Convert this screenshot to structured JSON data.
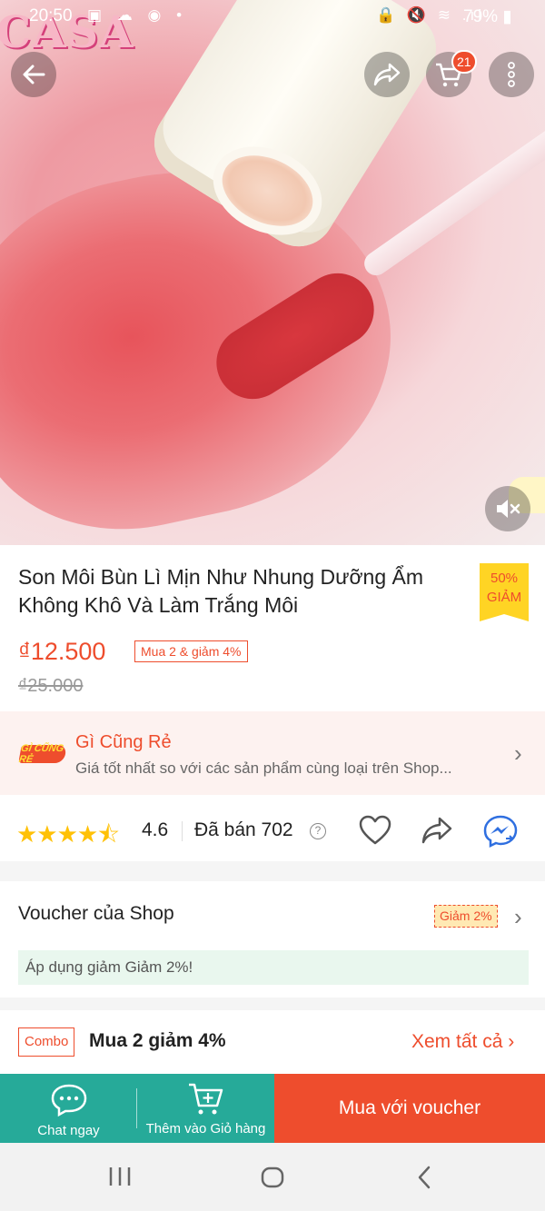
{
  "status_bar": {
    "time": "20:50",
    "left_icons": "▣ ☁ ◉ •",
    "right_icons": "🔒 🔇 ≋ .ıl",
    "battery": "79%"
  },
  "hero": {
    "logo_text": "CASA",
    "icons": {
      "back": "arrow-left-icon",
      "share": "share-icon",
      "cart": "cart-icon",
      "more": "more-vertical-icon",
      "mute": "volume-mute-icon"
    },
    "cart_badge": "21"
  },
  "product": {
    "title": "Son Môi Bùn Lì Mịn Như Nhung Dưỡng Ẩm Không Khô Và Làm Trắng Môi",
    "discount_tag": {
      "line1": "50%",
      "line2": "GIẢM"
    },
    "price": "₫12.500",
    "bundle_tag": "Mua 2 & giảm 4%",
    "old_price": "₫25.000"
  },
  "cheap_banner": {
    "logo_text": "GÌ CŨNG RẺ",
    "title": "Gì Cũng Rẻ",
    "subtitle": "Giá tốt nhất so với các sản phẩm cùng loại trên Shop..."
  },
  "rating": {
    "stars": "★★★★⯪",
    "value": "4.6",
    "sold": "Đã bán 702",
    "help": "?"
  },
  "voucher": {
    "title": "Voucher của Shop",
    "tag": "Giảm 2%",
    "note": "Áp dụng giảm Giảm 2%!"
  },
  "combo": {
    "tag": "Combo",
    "title": "Mua 2 giảm 4%",
    "see_all": "Xem tất cả"
  },
  "action_bar": {
    "chat_label": "Chat ngay",
    "add_cart_label": "Thêm vào Giỏ hàng",
    "buy_label": "Mua với voucher"
  },
  "colors": {
    "accent": "#ee4d2d",
    "teal": "#26aa99",
    "star": "#ffc107",
    "tag_yellow": "#ffd424"
  }
}
